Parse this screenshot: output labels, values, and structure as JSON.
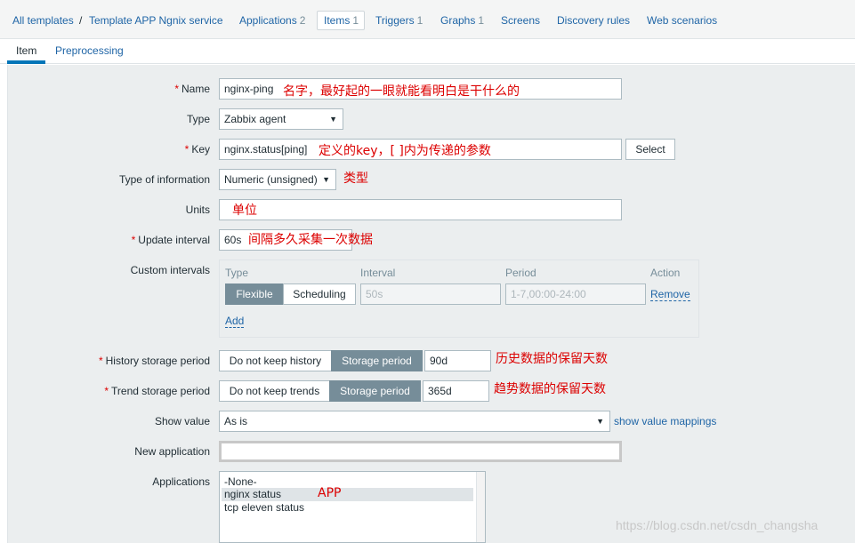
{
  "breadcrumb": {
    "all_templates": "All templates",
    "separator": "/",
    "template": "Template APP Ngnix service",
    "applications": "Applications",
    "applications_count": "2",
    "items": "Items",
    "items_count": "1",
    "triggers": "Triggers",
    "triggers_count": "1",
    "graphs": "Graphs",
    "graphs_count": "1",
    "screens": "Screens",
    "discovery": "Discovery rules",
    "web": "Web scenarios"
  },
  "tabs": {
    "item": "Item",
    "preprocessing": "Preprocessing"
  },
  "form": {
    "name_label": "Name",
    "name_value": "nginx-ping",
    "type_label": "Type",
    "type_value": "Zabbix agent",
    "key_label": "Key",
    "key_value": "nginx.status[ping]",
    "select_button": "Select",
    "type_info_label": "Type of information",
    "type_info_value": "Numeric (unsigned)",
    "units_label": "Units",
    "units_value": "",
    "update_label": "Update interval",
    "update_value": "60s",
    "custom_label": "Custom intervals",
    "custom": {
      "head_type": "Type",
      "head_interval": "Interval",
      "head_period": "Period",
      "head_action": "Action",
      "flexible": "Flexible",
      "scheduling": "Scheduling",
      "interval_placeholder": "50s",
      "period_placeholder": "1-7,00:00-24:00",
      "remove": "Remove",
      "add": "Add"
    },
    "history_label": "History storage period",
    "history_off": "Do not keep history",
    "history_on": "Storage period",
    "history_value": "90d",
    "trend_label": "Trend storage period",
    "trend_off": "Do not keep trends",
    "trend_on": "Storage period",
    "trend_value": "365d",
    "show_value_label": "Show value",
    "show_value_value": "As is",
    "show_mappings": "show value mappings",
    "new_app_label": "New application",
    "new_app_value": "",
    "apps_label": "Applications",
    "apps_options": [
      "-None-",
      "nginx status",
      "tcp eleven status"
    ]
  },
  "annotations": {
    "name_note": "名字，最好起的一眼就能看明白是干什么的",
    "key_note": "定义的key，[ ]内为传递的参数",
    "type_note": "类型",
    "units_note": "单位",
    "update_note": "间隔多久采集一次数据",
    "history_note": "历史数据的保留天数",
    "trend_note": "趋势数据的保留天数",
    "app_note": "APP"
  },
  "watermark": "https://blog.csdn.net/csdn_changsha",
  "colors": {
    "link": "#1f65a6",
    "required": "#dc0000",
    "toggle_active": "#768d99",
    "form_bg": "#ebeeef"
  }
}
